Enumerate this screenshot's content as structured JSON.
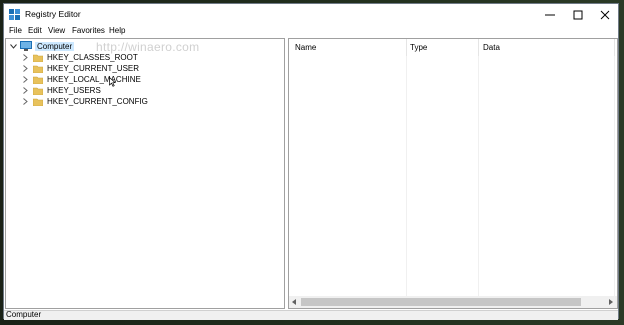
{
  "window": {
    "title": "Registry Editor",
    "controls": {
      "minimize": "minimize-icon",
      "maximize": "maximize-icon",
      "close": "close-icon"
    }
  },
  "menu": [
    "File",
    "Edit",
    "View",
    "Favorites",
    "Help"
  ],
  "watermark": "http://winaero.com",
  "tree": {
    "root": "Computer",
    "items": [
      "HKEY_CLASSES_ROOT",
      "HKEY_CURRENT_USER",
      "HKEY_LOCAL_MACHINE",
      "HKEY_USERS",
      "HKEY_CURRENT_CONFIG"
    ]
  },
  "columns": [
    "Name",
    "Type",
    "Data"
  ],
  "status": "Computer",
  "colors": {
    "selection": "#cce8ff",
    "folder": "#e8c25c",
    "accent": "#1a6fb5"
  }
}
